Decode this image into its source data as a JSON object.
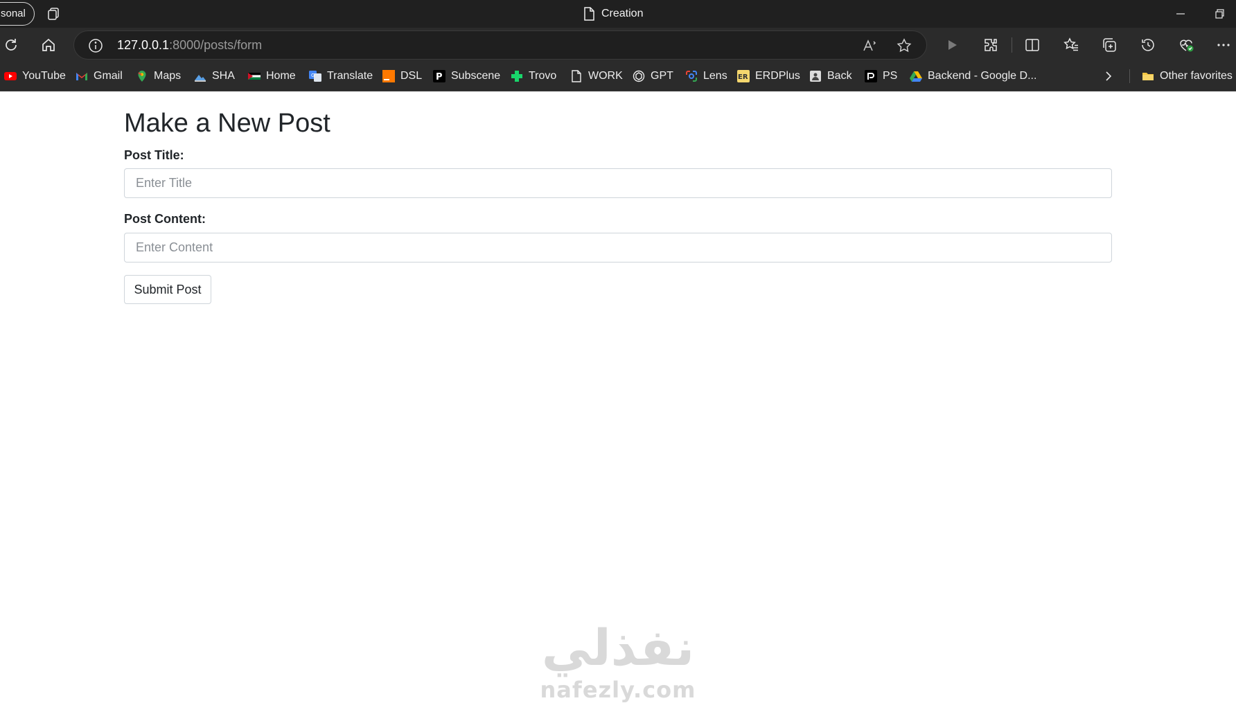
{
  "browser": {
    "profile_label": "sonal",
    "tab_title": "Creation",
    "address": {
      "host": "127.0.0.1",
      "rest": ":8000/posts/form"
    }
  },
  "bookmarks": [
    {
      "label": "YouTube",
      "icon": "youtube-icon",
      "color": "#ff0000"
    },
    {
      "label": "Gmail",
      "icon": "gmail-icon",
      "color": "#ea4335"
    },
    {
      "label": "Maps",
      "icon": "maps-icon",
      "color": "#34a853"
    },
    {
      "label": "SHA",
      "icon": "sha-icon",
      "color": "#4a90d9"
    },
    {
      "label": "Home",
      "icon": "palestine-flag-icon",
      "color": "#007a3d"
    },
    {
      "label": "Translate",
      "icon": "translate-icon",
      "color": "#4285f4"
    },
    {
      "label": "DSL",
      "icon": "dsl-icon",
      "color": "#ff7900"
    },
    {
      "label": "Subscene",
      "icon": "subscene-icon",
      "color": "#000000"
    },
    {
      "label": "Trovo",
      "icon": "trovo-icon",
      "color": "#19d66b"
    },
    {
      "label": "WORK",
      "icon": "page-icon",
      "color": "#ededed"
    },
    {
      "label": "GPT",
      "icon": "openai-icon",
      "color": "#ededed"
    },
    {
      "label": "Lens",
      "icon": "lens-icon",
      "color": "#4285f4"
    },
    {
      "label": "ERDPlus",
      "icon": "erdplus-icon",
      "color": "#f5d76e"
    },
    {
      "label": "Back",
      "icon": "back-icon",
      "color": "#dddddd"
    },
    {
      "label": "PS",
      "icon": "ps-icon",
      "color": "#000000"
    },
    {
      "label": "Backend - Google D...",
      "icon": "google-drive-icon",
      "color": "#fbbc04"
    }
  ],
  "other_favorites_label": "Other favorites",
  "form": {
    "heading": "Make a New Post",
    "title_label": "Post Title:",
    "title_placeholder": "Enter Title",
    "content_label": "Post Content:",
    "content_placeholder": "Enter Content",
    "submit_label": "Submit Post"
  },
  "watermark": {
    "arabic": "نفذلي",
    "latin": "nafezly.com"
  }
}
